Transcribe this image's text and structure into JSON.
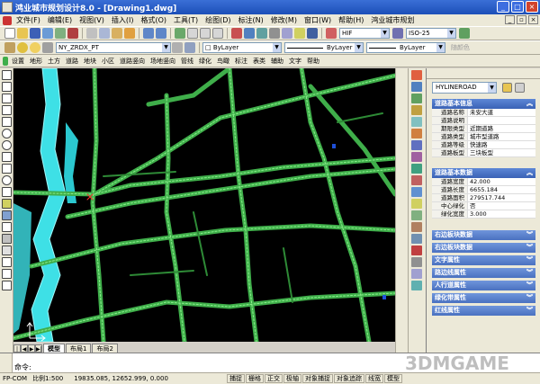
{
  "window": {
    "title": "鸿业城市规划设计8.0 - [Drawing1.dwg]"
  },
  "menubar": {
    "items": [
      "文件(F)",
      "编辑(E)",
      "视图(V)",
      "插入(I)",
      "格式(O)",
      "工具(T)",
      "绘图(D)",
      "标注(N)",
      "修改(M)",
      "窗口(W)",
      "帮助(H)",
      "鸿业城市规划"
    ]
  },
  "toolbar1": {
    "hif_combo": "HIF",
    "iso_combo": "ISO-25"
  },
  "toolbar2": {
    "layer_combo": "NY_ZRDX_PT",
    "color_combo": "ByLayer",
    "linetype_combo": "ByLayer",
    "lineweight_combo": "ByLayer",
    "plot_style": "随颜色"
  },
  "plugbar": {
    "items": [
      "设置",
      "地形",
      "土方",
      "道路",
      "地块",
      "小区",
      "道路竖向",
      "场地竖向",
      "管线",
      "绿化",
      "鸟瞰",
      "标注",
      "表类",
      "辅助",
      "文字",
      "帮助"
    ]
  },
  "layout_tabs": [
    "模型",
    "布局1",
    "布局2"
  ],
  "panel": {
    "object_select": "HYLINEROAD",
    "sections": [
      {
        "title": "道路基本信息",
        "rows": [
          {
            "key": "道路名称",
            "value": "未安大道"
          },
          {
            "key": "道路说明",
            "value": ""
          },
          {
            "key": "期限类型",
            "value": "近期道路"
          },
          {
            "key": "道路类型",
            "value": "城市型道路"
          },
          {
            "key": "道路等级",
            "value": "快速路"
          },
          {
            "key": "道路板型",
            "value": "三块板型"
          }
        ]
      },
      {
        "title": "道路基本数据",
        "rows": [
          {
            "key": "道路宽度",
            "value": "42.000"
          },
          {
            "key": "道路长度",
            "value": "6655.184"
          },
          {
            "key": "道路面积",
            "value": "279517.744"
          },
          {
            "key": "中心绿化",
            "value": "否"
          },
          {
            "key": "绿化宽度",
            "value": "3.000"
          }
        ]
      }
    ],
    "collapsed": [
      "右边板块数据",
      "右边板块数据",
      "文字属性",
      "路边线属性",
      "人行道属性",
      "绿化带属性",
      "红线属性"
    ]
  },
  "command": {
    "prompt": "命令:"
  },
  "statusbar": {
    "app": "FP-COM",
    "scale": "比例1:500",
    "coords": "19835.085, 12652.999, 0.000",
    "modes": [
      "捕捉",
      "栅格",
      "正交",
      "极轴",
      "对象捕捉",
      "对象追踪",
      "线宽",
      "模型"
    ]
  },
  "watermark": "3DMGAME",
  "colors": {
    "title_bar": "#1c4fb8",
    "road": "#3fae4a",
    "road_highlight": "#8af08c",
    "river": "#3ee0e6",
    "canvas_bg": "#000000",
    "section_header": "#3a62b5"
  }
}
